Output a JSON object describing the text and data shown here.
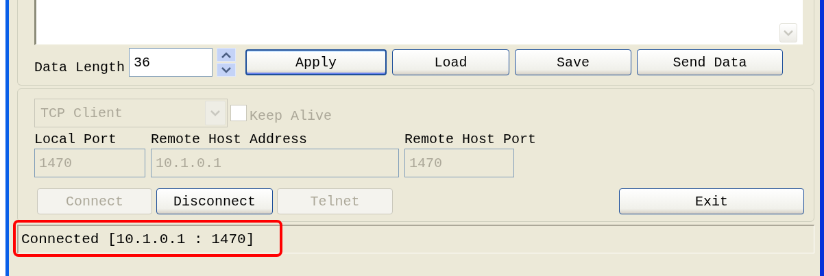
{
  "data_length": {
    "label": "Data Length",
    "value": "36"
  },
  "data_buttons": [
    {
      "label": "Apply",
      "default": true
    },
    {
      "label": "Load",
      "default": false
    },
    {
      "label": "Save",
      "default": false
    },
    {
      "label": "Send Data",
      "default": false
    }
  ],
  "connection": {
    "mode": {
      "value": "TCP Client",
      "disabled": true
    },
    "keep_alive": {
      "label": "Keep Alive",
      "checked": false,
      "disabled": true
    },
    "fields": [
      {
        "label": "Local Port",
        "value": "1470",
        "disabled": true
      },
      {
        "label": "Remote Host Address",
        "value": "10.1.0.1",
        "disabled": true
      },
      {
        "label": "Remote Host Port",
        "value": "1470",
        "disabled": true
      }
    ],
    "buttons": [
      {
        "label": "Connect",
        "disabled": true
      },
      {
        "label": "Disconnect",
        "disabled": false
      },
      {
        "label": "Telnet",
        "disabled": true
      }
    ],
    "exit_button": {
      "label": "Exit"
    }
  },
  "status_bar": {
    "text": "Connected [10.1.0.1 : 1470]",
    "highlighted": true
  }
}
